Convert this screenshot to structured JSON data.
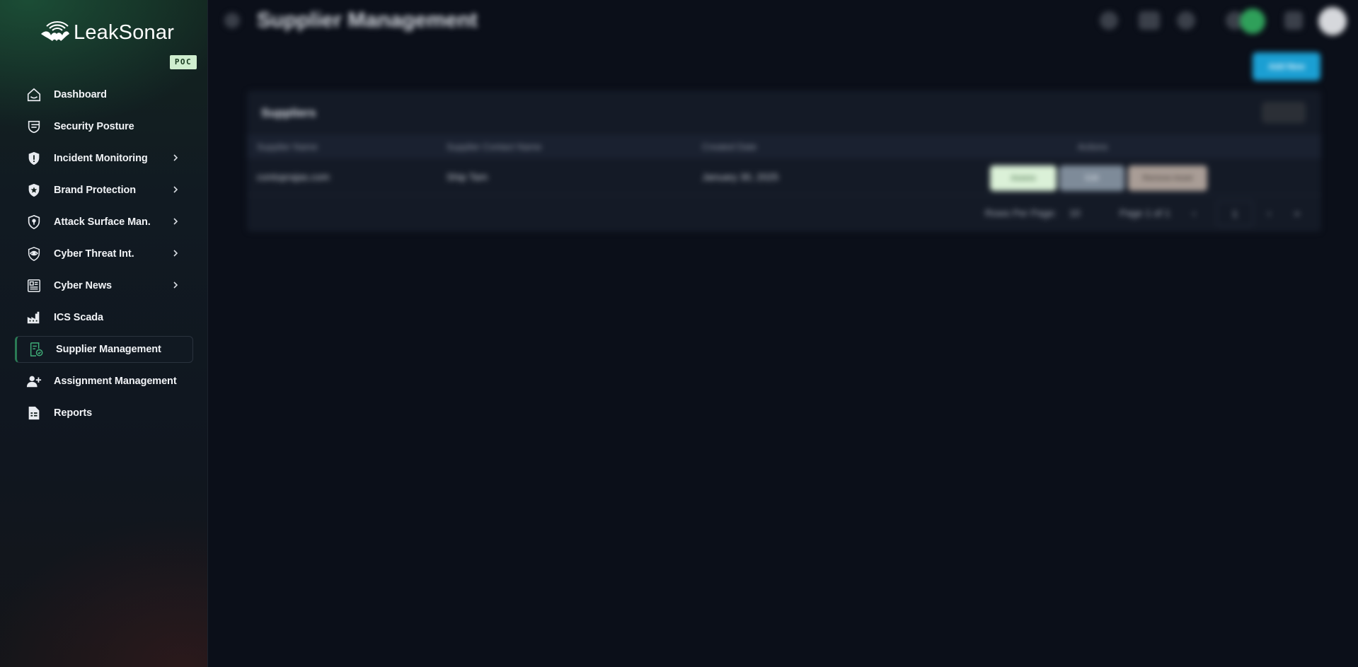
{
  "brand": {
    "name": "LeakSonar",
    "badge": "POC"
  },
  "sidebar": {
    "items": [
      {
        "label": "Dashboard",
        "has_submenu": false,
        "active": false,
        "icon": "home-icon"
      },
      {
        "label": "Security Posture",
        "has_submenu": false,
        "active": false,
        "icon": "posture-icon"
      },
      {
        "label": "Incident Monitoring",
        "has_submenu": true,
        "active": false,
        "icon": "shield-alert-icon"
      },
      {
        "label": "Brand Protection",
        "has_submenu": true,
        "active": false,
        "icon": "shield-star-icon"
      },
      {
        "label": "Attack Surface Man.",
        "has_submenu": true,
        "active": false,
        "icon": "shield-keyhole-icon"
      },
      {
        "label": "Cyber Threat Int.",
        "has_submenu": true,
        "active": false,
        "icon": "eye-badge-icon"
      },
      {
        "label": "Cyber News",
        "has_submenu": true,
        "active": false,
        "icon": "newspaper-icon"
      },
      {
        "label": "ICS Scada",
        "has_submenu": false,
        "active": false,
        "icon": "factory-icon"
      },
      {
        "label": "Supplier Management",
        "has_submenu": false,
        "active": true,
        "icon": "supplier-doc-icon"
      },
      {
        "label": "Assignment Management",
        "has_submenu": false,
        "active": false,
        "icon": "user-plus-icon"
      },
      {
        "label": "Reports",
        "has_submenu": false,
        "active": false,
        "icon": "report-icon"
      }
    ]
  },
  "header": {
    "title": "Supplier Management"
  },
  "toolbar": {
    "add_label": "Add New"
  },
  "card": {
    "title": "Suppliers",
    "columns": [
      "Supplier Name",
      "Supplier Contact Name",
      "Created Date",
      "Actions"
    ],
    "rows": [
      {
        "name": "contoprajas.com",
        "contact": "Ship Tam",
        "created": "January 30, 2025"
      }
    ],
    "actions": {
      "view": "Assess",
      "edit": "Edit",
      "delete": "Remove Asset"
    },
    "pagination": {
      "rows_label": "Rows Per Page:",
      "rows_value": "10",
      "page_info": "Page 1 of 1",
      "current_page": "1"
    }
  },
  "colors": {
    "active_accent": "#2a7a55",
    "primary_button": "#1b9fd3",
    "poc_badge": "#cfeecf"
  }
}
